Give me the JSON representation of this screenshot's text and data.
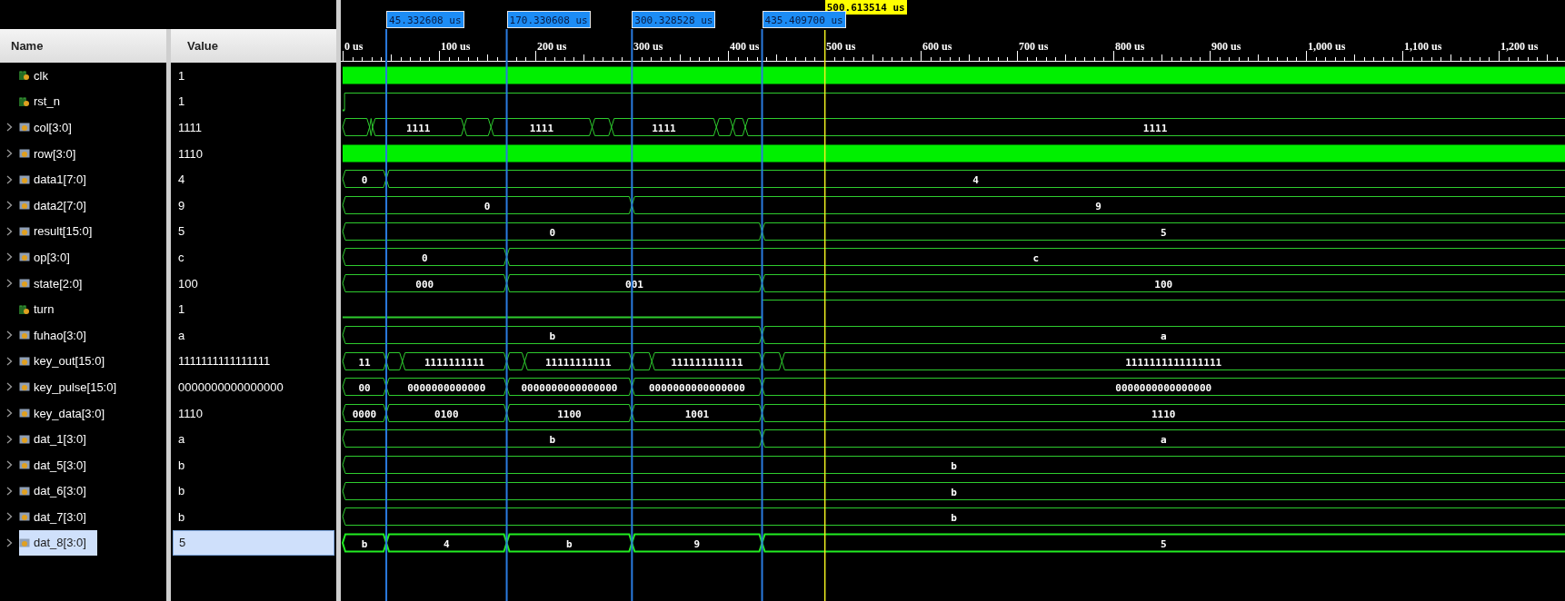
{
  "columns": {
    "name": "Name",
    "value": "Value"
  },
  "cursor": {
    "time": "500.613514 us"
  },
  "markers": [
    {
      "time": "45.332608 us"
    },
    {
      "time": "170.330608 us"
    },
    {
      "time": "300.328528 us"
    },
    {
      "time": "435.409700 us"
    }
  ],
  "ruler": {
    "ticks": [
      "0 us",
      "100 us",
      "200 us",
      "300 us",
      "400 us",
      "500 us",
      "600 us",
      "700 us",
      "800 us",
      "900 us",
      "1,000 us",
      "1,100 us",
      "1,200 us"
    ]
  },
  "signals": [
    {
      "name": "clk",
      "value": "1",
      "kind": "bit",
      "selected": false,
      "wave": {
        "kind": "clock"
      }
    },
    {
      "name": "rst_n",
      "value": "1",
      "kind": "bit",
      "selected": false,
      "wave": {
        "kind": "bits",
        "segments": [
          {
            "high": false
          },
          {
            "high": true
          }
        ]
      }
    },
    {
      "name": "col[3:0]",
      "value": "1111",
      "kind": "bus",
      "selected": false,
      "wave": {
        "kind": "bus",
        "segments": [
          {
            "value": "1111"
          },
          {
            "value": "1111"
          },
          {
            "value": "1111"
          },
          {
            "value": "1111"
          }
        ]
      }
    },
    {
      "name": "row[3:0]",
      "value": "1110",
      "kind": "bus",
      "selected": false,
      "wave": {
        "kind": "dense"
      }
    },
    {
      "name": "data1[7:0]",
      "value": "4",
      "kind": "bus",
      "selected": false,
      "wave": {
        "kind": "bus",
        "segments": [
          {
            "value": "0"
          },
          {
            "value": "4"
          }
        ]
      }
    },
    {
      "name": "data2[7:0]",
      "value": "9",
      "kind": "bus",
      "selected": false,
      "wave": {
        "kind": "bus",
        "segments": [
          {
            "value": "0"
          },
          {
            "value": "9"
          }
        ]
      }
    },
    {
      "name": "result[15:0]",
      "value": "5",
      "kind": "bus",
      "selected": false,
      "wave": {
        "kind": "bus",
        "segments": [
          {
            "value": "0"
          },
          {
            "value": "5"
          }
        ]
      }
    },
    {
      "name": "op[3:0]",
      "value": "c",
      "kind": "bus",
      "selected": false,
      "wave": {
        "kind": "bus",
        "segments": [
          {
            "value": "0"
          },
          {
            "value": "c"
          }
        ]
      }
    },
    {
      "name": "state[2:0]",
      "value": "100",
      "kind": "bus",
      "selected": false,
      "wave": {
        "kind": "bus",
        "segments": [
          {
            "value": "000"
          },
          {
            "value": "001"
          },
          {
            "value": "100"
          }
        ]
      }
    },
    {
      "name": "turn",
      "value": "1",
      "kind": "bit",
      "selected": false,
      "wave": {
        "kind": "bits",
        "segments": [
          {
            "high": false
          },
          {
            "high": true
          }
        ]
      }
    },
    {
      "name": "fuhao[3:0]",
      "value": "a",
      "kind": "bus",
      "selected": false,
      "wave": {
        "kind": "bus",
        "segments": [
          {
            "value": "b"
          },
          {
            "value": "a"
          }
        ]
      }
    },
    {
      "name": "key_out[15:0]",
      "value": "1111111111111111",
      "kind": "bus",
      "selected": false,
      "wave": {
        "kind": "bus",
        "segments": [
          {
            "value": "11"
          },
          {
            "value": "1111111111"
          },
          {
            "value": "11111111111"
          },
          {
            "value": "111111111111"
          },
          {
            "value": "1111111111111111"
          }
        ]
      }
    },
    {
      "name": "key_pulse[15:0]",
      "value": "0000000000000000",
      "kind": "bus",
      "selected": false,
      "wave": {
        "kind": "bus",
        "segments": [
          {
            "value": "00"
          },
          {
            "value": "0000000000000"
          },
          {
            "value": "0000000000000000"
          },
          {
            "value": "0000000000000000"
          },
          {
            "value": "0000000000000000"
          }
        ]
      }
    },
    {
      "name": "key_data[3:0]",
      "value": "1110",
      "kind": "bus",
      "selected": false,
      "wave": {
        "kind": "bus",
        "segments": [
          {
            "value": "0000"
          },
          {
            "value": "0100"
          },
          {
            "value": "1100"
          },
          {
            "value": "1001"
          },
          {
            "value": "1110"
          }
        ]
      }
    },
    {
      "name": "dat_1[3:0]",
      "value": "a",
      "kind": "bus",
      "selected": false,
      "wave": {
        "kind": "bus",
        "segments": [
          {
            "value": "b"
          },
          {
            "value": "a"
          }
        ]
      }
    },
    {
      "name": "dat_5[3:0]",
      "value": "b",
      "kind": "bus",
      "selected": false,
      "wave": {
        "kind": "bus",
        "segments": [
          {
            "value": "b"
          }
        ]
      }
    },
    {
      "name": "dat_6[3:0]",
      "value": "b",
      "kind": "bus",
      "selected": false,
      "wave": {
        "kind": "bus",
        "segments": [
          {
            "value": "b"
          }
        ]
      }
    },
    {
      "name": "dat_7[3:0]",
      "value": "b",
      "kind": "bus",
      "selected": false,
      "wave": {
        "kind": "bus",
        "segments": [
          {
            "value": "b"
          }
        ]
      }
    },
    {
      "name": "dat_8[3:0]",
      "value": "5",
      "kind": "bus",
      "selected": true,
      "wave": {
        "kind": "bus",
        "segments": [
          {
            "value": "b"
          },
          {
            "value": "4"
          },
          {
            "value": "b"
          },
          {
            "value": "9"
          },
          {
            "value": "5"
          }
        ]
      }
    }
  ]
}
